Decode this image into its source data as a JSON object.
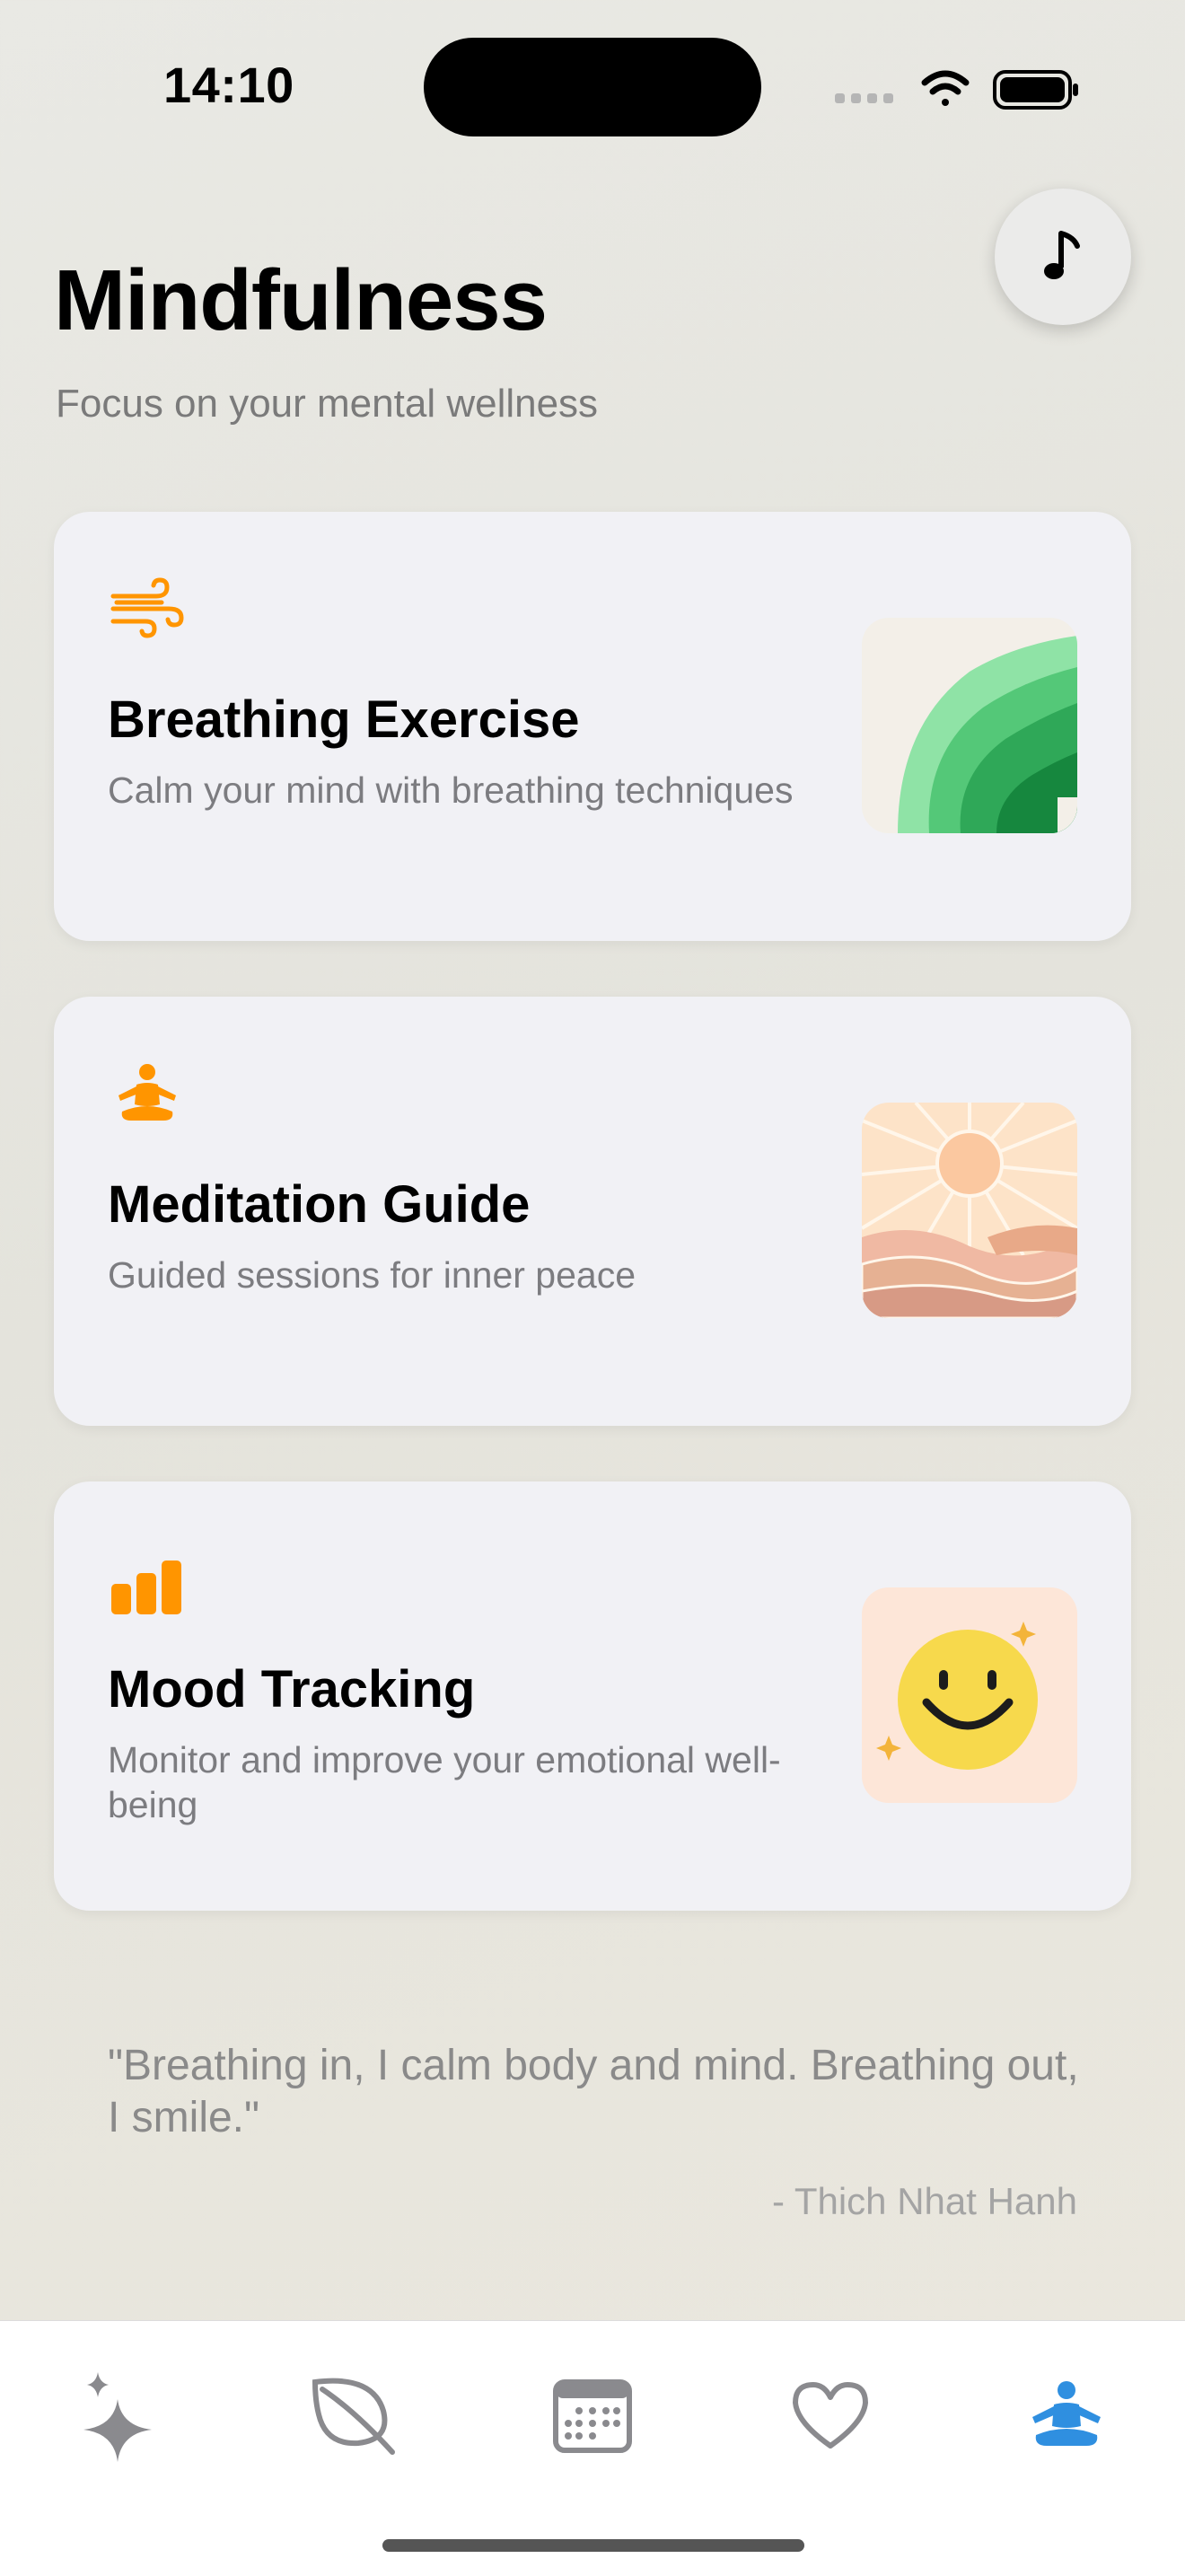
{
  "status_bar": {
    "time": "14:10"
  },
  "header": {
    "title": "Mindfulness",
    "subtitle": "Focus on your mental wellness",
    "music_icon": "music-note-icon"
  },
  "cards": [
    {
      "title": "Breathing Exercise",
      "description": "Calm your mind with breathing techniques",
      "icon": "wind-icon"
    },
    {
      "title": "Meditation Guide",
      "description": "Guided sessions for inner peace",
      "icon": "meditation-figure-icon"
    },
    {
      "title": "Mood Tracking",
      "description": "Monitor and improve your emotional well-being",
      "icon": "bar-chart-icon"
    }
  ],
  "quote": {
    "text": "\"Breathing in, I calm body and mind. Breathing out, I smile.\"",
    "author": "- Thich Nhat Hanh"
  },
  "tab_bar": {
    "items": [
      {
        "name": "sparkles-icon",
        "active": false
      },
      {
        "name": "leaf-icon",
        "active": false
      },
      {
        "name": "calendar-icon",
        "active": false
      },
      {
        "name": "heart-icon",
        "active": false
      },
      {
        "name": "meditation-figure-icon",
        "active": true
      }
    ]
  },
  "colors": {
    "accent_orange": "#ff9500",
    "tab_active": "#2f8fe0",
    "tab_inactive": "#8a8a8e"
  }
}
